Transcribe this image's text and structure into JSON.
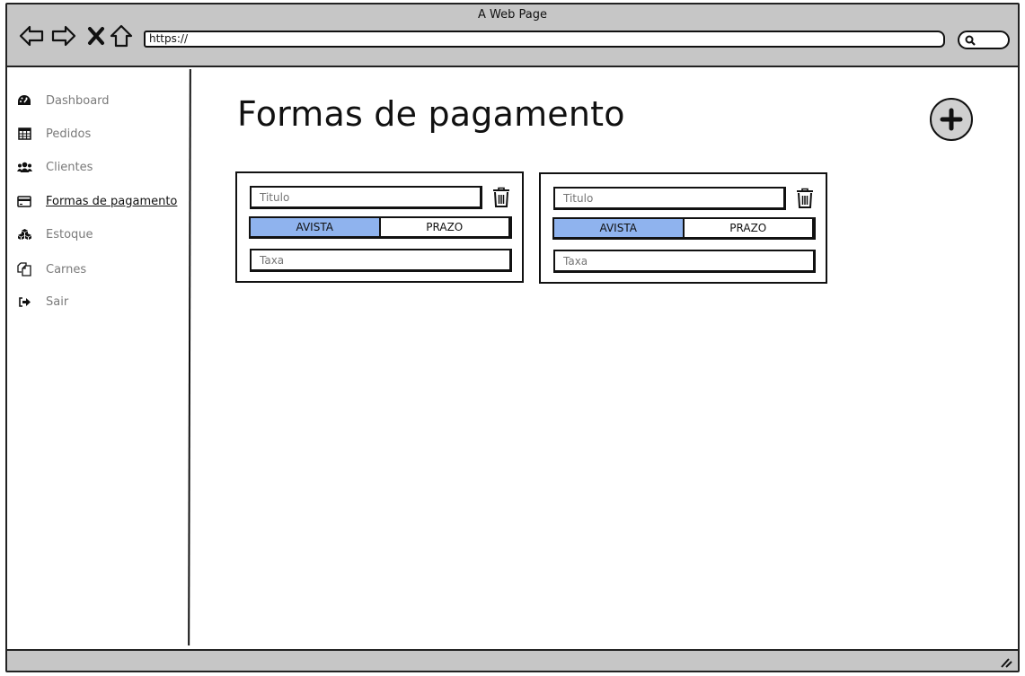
{
  "window": {
    "title": "A Web Page"
  },
  "browser": {
    "url": "https://",
    "nav_icons": [
      "back-icon",
      "forward-icon",
      "close-icon",
      "home-icon"
    ],
    "search_icon": "search-icon"
  },
  "sidebar": {
    "items": [
      {
        "label": "Dashboard",
        "icon": "dashboard-icon"
      },
      {
        "label": "Pedidos",
        "icon": "table-icon"
      },
      {
        "label": "Clientes",
        "icon": "users-icon"
      },
      {
        "label": "Formas de pagamento",
        "icon": "credit-card-icon",
        "active": true
      },
      {
        "label": "Estoque",
        "icon": "cubes-icon"
      },
      {
        "label": "Carnes",
        "icon": "copy-icon"
      },
      {
        "label": "Sair",
        "icon": "sign-out-icon"
      }
    ]
  },
  "main": {
    "title": "Formas de pagamento",
    "add_button_icon": "plus-circle-icon",
    "cards": [
      {
        "title_placeholder": "Titulo",
        "options": [
          "AVISTA",
          "PRAZO"
        ],
        "selected_option": "AVISTA",
        "fee_placeholder": "Taxa"
      },
      {
        "title_placeholder": "Titulo",
        "options": [
          "AVISTA",
          "PRAZO"
        ],
        "selected_option": "AVISTA",
        "fee_placeholder": "Taxa"
      }
    ]
  },
  "colors": {
    "chrome": "#c6c6c6",
    "selected_segment": "#8fb3ee",
    "add_button": "#d0d0d0"
  }
}
